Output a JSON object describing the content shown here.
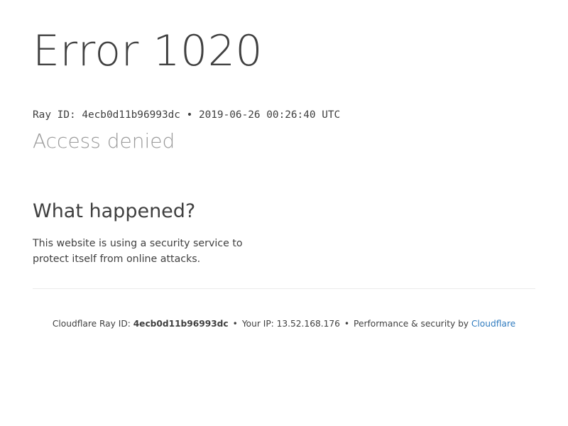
{
  "error": {
    "title": "Error 1020",
    "ray_line": {
      "prefix": "Ray ID: ",
      "ray_id": "4ecb0d11b96993dc",
      "separator": " • ",
      "timestamp": "2019-06-26 00:26:40 UTC"
    },
    "subtitle": "Access denied"
  },
  "what_happened": {
    "heading": "What happened?",
    "body": "This website is using a security service to protect itself from online attacks."
  },
  "footer": {
    "ray_label": "Cloudflare Ray ID: ",
    "ray_id": "4ecb0d11b96993dc",
    "bullet": "•",
    "ip_label": "Your IP: ",
    "ip": "13.52.168.176",
    "perf_label": "Performance & security by ",
    "link_text": "Cloudflare"
  },
  "colors": {
    "text": "#404040",
    "muted": "#999999",
    "link": "#2f7bbf",
    "divider": "#ebebeb"
  }
}
